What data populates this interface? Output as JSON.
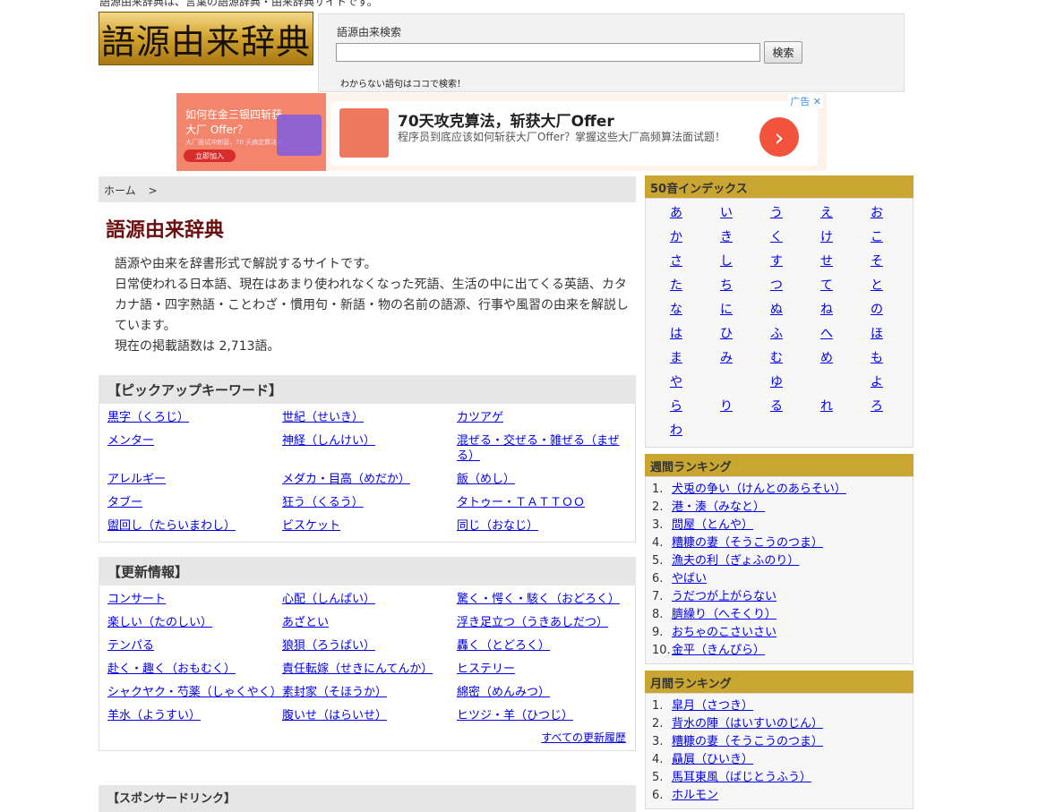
{
  "header": {
    "tagline": "語源由来辞典は、言葉の語源辞典・由来辞典サイトです。",
    "logo_text": "語源由来辞典"
  },
  "search": {
    "label": "語源由来検索",
    "value": "",
    "button_label": "検索",
    "hint": "わからない語句はココで検索！"
  },
  "ad": {
    "label": "广告",
    "left_text": "如何在金三银四斩获大厂 Offer？",
    "left_small": "大厂面试冲刺营，70 天搞定算法面",
    "left_button": "立即加入",
    "title": "70天攻克算法，斩获大厂Offer",
    "description": "程序员到底应该如何斩获大厂Offer？掌握这些大厂高频算法面试题！",
    "close_icon": "close-icon",
    "arrow_icon": "chevron-right-icon"
  },
  "breadcrumb": {
    "home": "ホーム",
    "separator": ">"
  },
  "main": {
    "title": "語源由来辞典",
    "intro": [
      "語源や由来を辞書形式で解説するサイトです。",
      "日常使われる日本語、現在はあまり使われなくなった死語、生活の中に出てくる英語、カタカナ語・四字熟語・ことわざ・慣用句・新語・物の名前の語源、行事や風習の由来を解説しています。",
      "現在の掲載語数は 2,713語。"
    ]
  },
  "pickup": {
    "title": "【ピックアップキーワード】",
    "items": [
      "黒字（くろじ）",
      "世紀（せいき）",
      "カツアゲ",
      "メンター",
      "神経（しんけい）",
      "混ぜる・交ぜる・雑ぜる（まぜる）",
      "アレルギー",
      "メダカ・目高（めだか）",
      "飯（めし）",
      "タブー",
      "狂う（くるう）",
      "タトゥー・ＴＡＴＴＯＯ",
      "盥回し（たらいまわし）",
      "ビスケット",
      "同じ（おなじ）"
    ]
  },
  "updates": {
    "title": "【更新情報】",
    "items": [
      "コンサート",
      "心配（しんぱい）",
      "驚く・愕く・駭く（おどろく）",
      "楽しい（たのしい）",
      "あざとい",
      "浮き足立つ（うきあしだつ）",
      "テンパる",
      "狼狽（ろうばい）",
      "轟く（とどろく）",
      "赴く・趣く（おもむく）",
      "責任転嫁（せきにんてんか）",
      "ヒステリー",
      "シャクヤク・芍薬（しゃくやく）",
      "素封家（そほうか）",
      "綿密（めんみつ）",
      "羊水（ようすい）",
      "腹いせ（はらいせ）",
      "ヒツジ・羊（ひつじ）"
    ],
    "more_link": "すべての更新履歴"
  },
  "sponsor": {
    "title": "【スポンサードリンク】"
  },
  "sidebar": {
    "kana_index": {
      "title": "50音インデックス",
      "rows": [
        [
          "あ",
          "い",
          "う",
          "え",
          "お"
        ],
        [
          "か",
          "き",
          "く",
          "け",
          "こ"
        ],
        [
          "さ",
          "し",
          "す",
          "せ",
          "そ"
        ],
        [
          "た",
          "ち",
          "つ",
          "て",
          "と"
        ],
        [
          "な",
          "に",
          "ぬ",
          "ね",
          "の"
        ],
        [
          "は",
          "ひ",
          "ふ",
          "へ",
          "ほ"
        ],
        [
          "ま",
          "み",
          "む",
          "め",
          "も"
        ],
        [
          "や",
          "",
          "ゆ",
          "",
          "よ"
        ],
        [
          "ら",
          "り",
          "る",
          "れ",
          "ろ"
        ],
        [
          "わ",
          "",
          "",
          "",
          ""
        ]
      ]
    },
    "weekly": {
      "title": "週間ランキング",
      "items": [
        {
          "num": "1.",
          "label": "犬兎の争い（けんとのあらそい）"
        },
        {
          "num": "2.",
          "label": "港・湊（みなと）"
        },
        {
          "num": "3.",
          "label": "問屋（とんや）"
        },
        {
          "num": "4.",
          "label": "糟糠の妻（そうこうのつま）"
        },
        {
          "num": "5.",
          "label": "漁夫の利（ぎょふのり）"
        },
        {
          "num": "6.",
          "label": "やばい"
        },
        {
          "num": "7.",
          "label": "うだつが上がらない"
        },
        {
          "num": "8.",
          "label": "臍繰り（へそくり）"
        },
        {
          "num": "9.",
          "label": "おちゃのこさいさい"
        },
        {
          "num": "10.",
          "label": "金平（きんぴら）"
        }
      ]
    },
    "monthly": {
      "title": "月間ランキング",
      "items": [
        {
          "num": "1.",
          "label": "皐月（さつき）"
        },
        {
          "num": "2.",
          "label": "背水の陣（はいすいのじん）"
        },
        {
          "num": "3.",
          "label": "糟糠の妻（そうこうのつま）"
        },
        {
          "num": "4.",
          "label": "贔屓（ひいき）"
        },
        {
          "num": "5.",
          "label": "馬耳東風（ばじとうふう）"
        },
        {
          "num": "6.",
          "label": "ホルモン"
        }
      ]
    }
  }
}
